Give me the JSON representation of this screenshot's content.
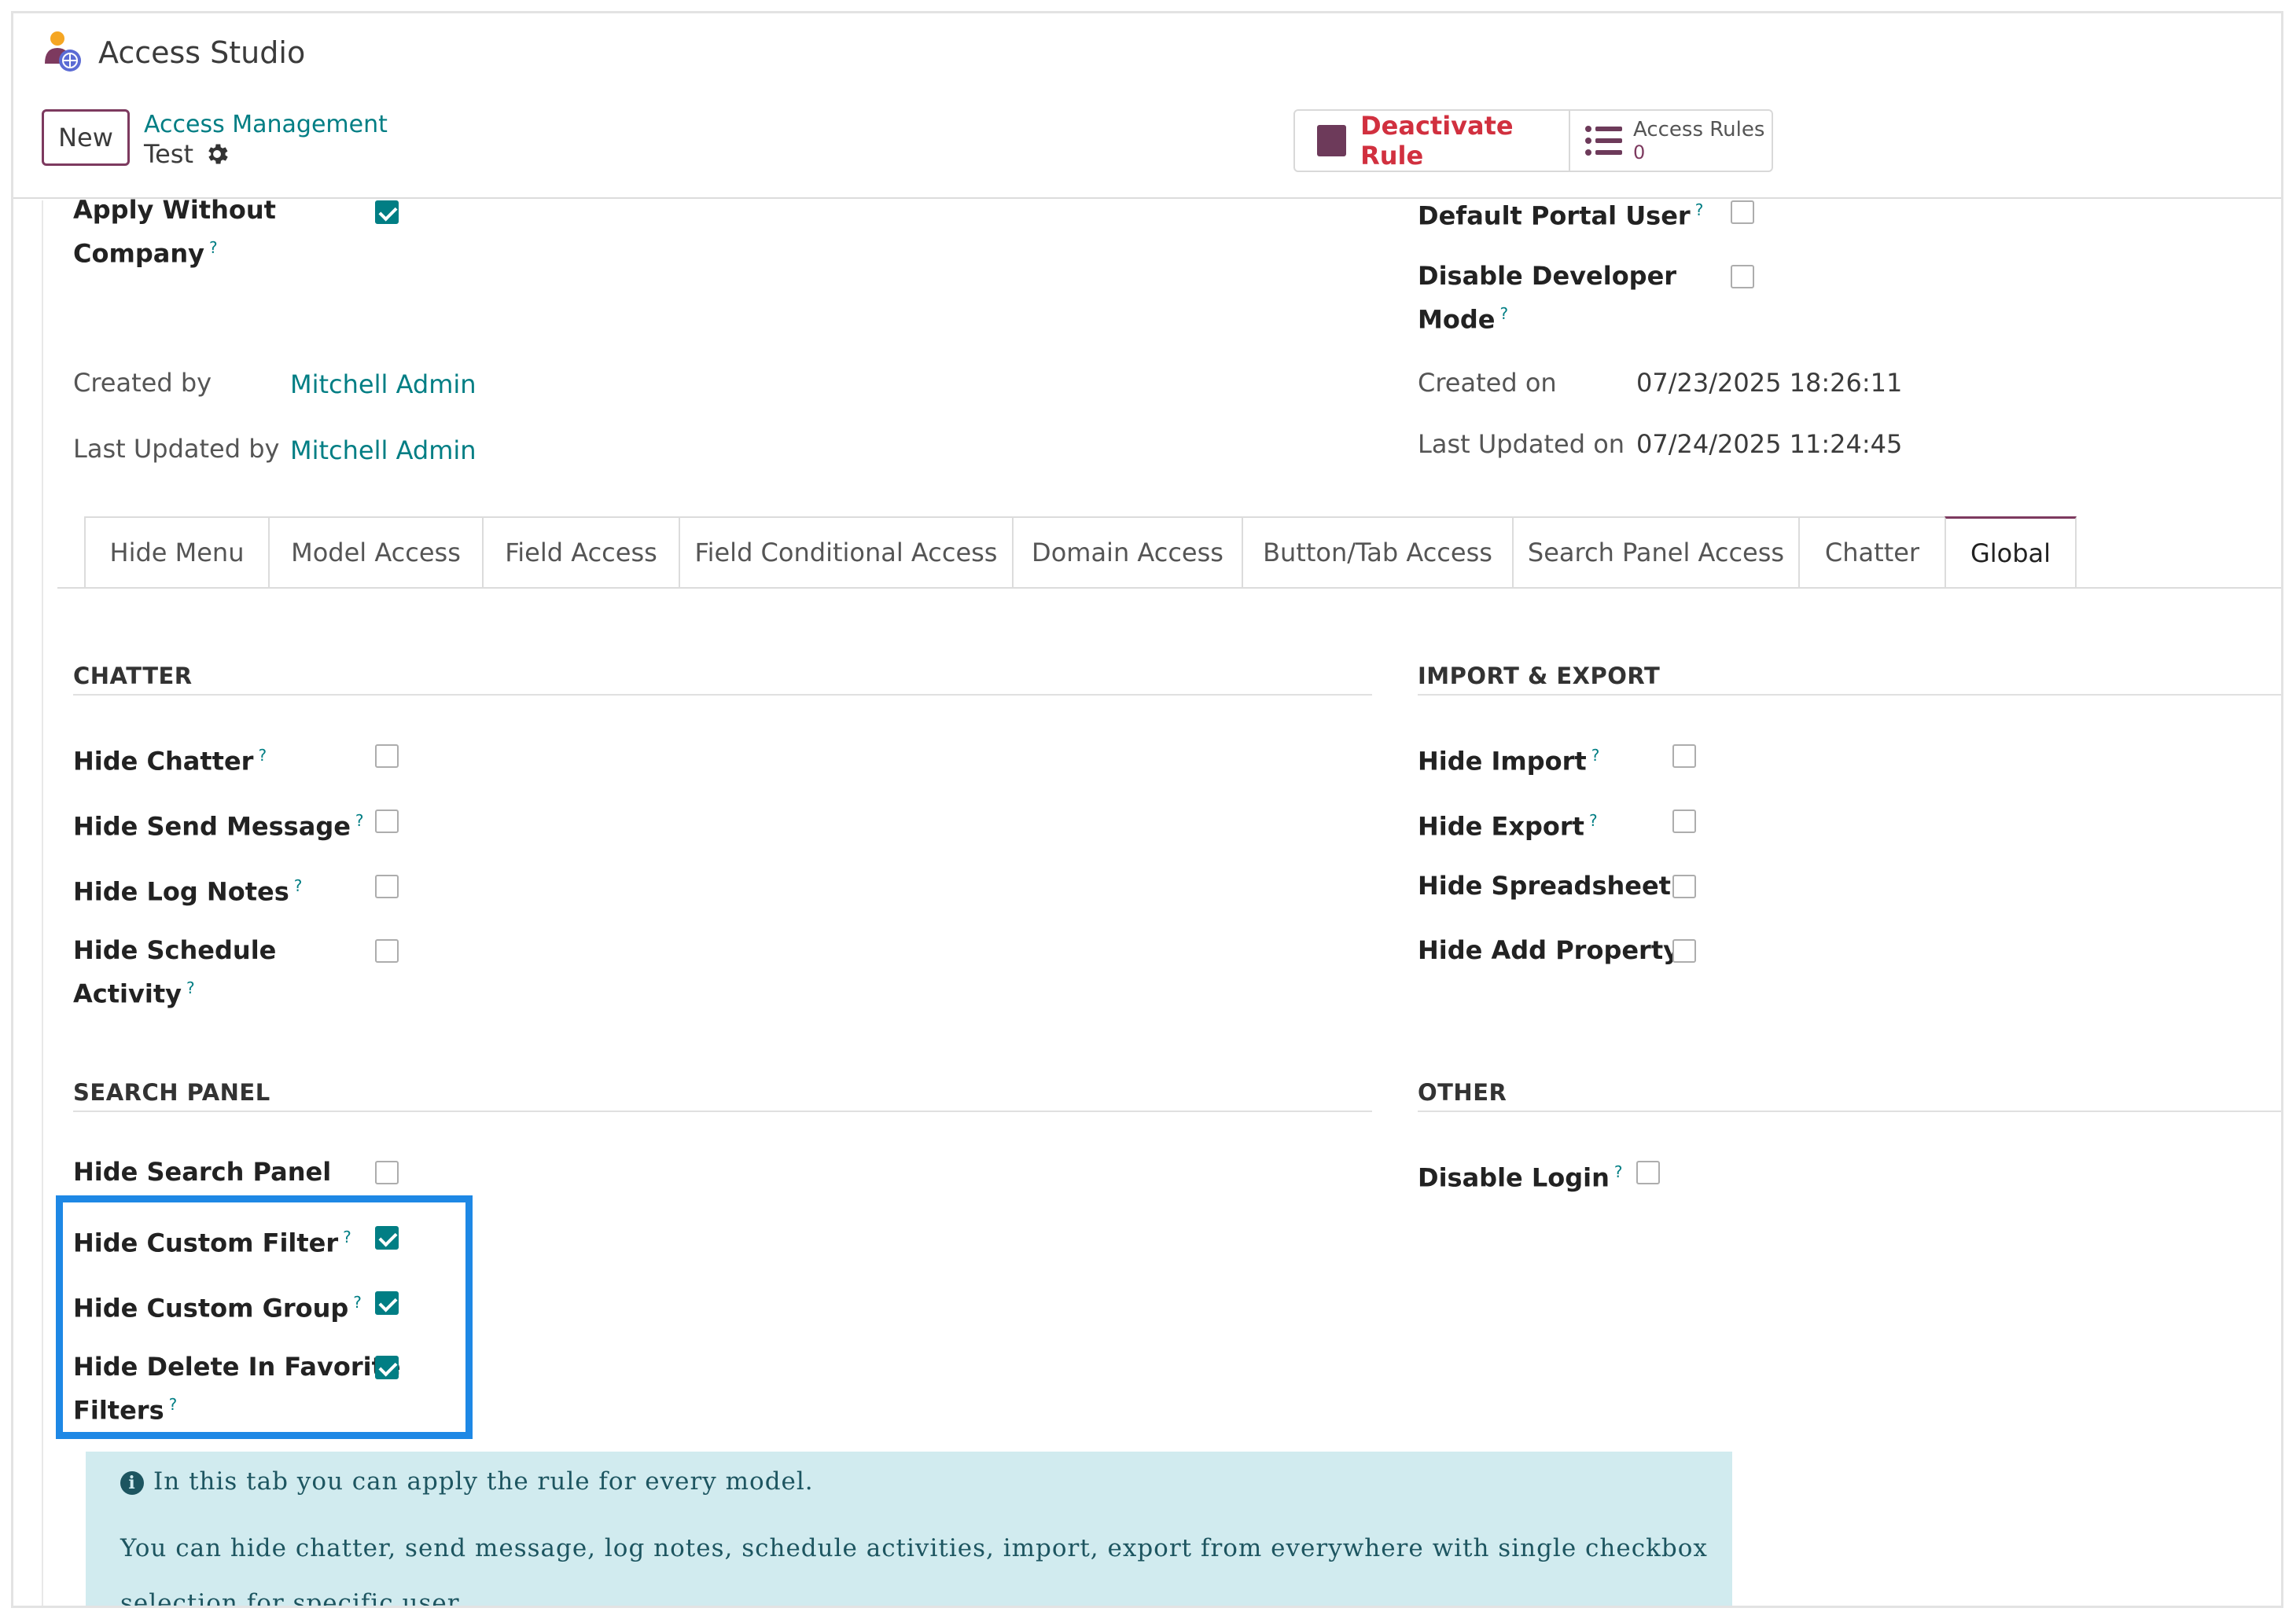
{
  "app": {
    "title": "Access Studio"
  },
  "header": {
    "new_label": "New",
    "breadcrumb_parent": "Access Management",
    "breadcrumb_current": "Test",
    "deactivate_label": "Deactivate Rule",
    "access_rules_label": "Access Rules",
    "access_rules_count": "0"
  },
  "top_fields": {
    "apply_without_company": {
      "label_line1": "Apply Without",
      "label_line2": "Company",
      "checked": true
    },
    "default_portal_user": {
      "label": "Default Portal User",
      "checked": false
    },
    "disable_developer_mode": {
      "label_line1": "Disable Developer",
      "label_line2": "Mode",
      "checked": false
    },
    "created_by": {
      "label": "Created by",
      "value": "Mitchell Admin"
    },
    "last_updated_by": {
      "label": "Last Updated by",
      "value": "Mitchell Admin"
    },
    "created_on": {
      "label": "Created on",
      "value": "07/23/2025 18:26:11"
    },
    "last_updated_on": {
      "label": "Last Updated on",
      "value": "07/24/2025 11:24:45"
    }
  },
  "tabs": [
    {
      "label": "Hide Menu",
      "active": false
    },
    {
      "label": "Model Access",
      "active": false
    },
    {
      "label": "Field Access",
      "active": false
    },
    {
      "label": "Field Conditional Access",
      "active": false
    },
    {
      "label": "Domain Access",
      "active": false
    },
    {
      "label": "Button/Tab Access",
      "active": false
    },
    {
      "label": "Search Panel Access",
      "active": false
    },
    {
      "label": "Chatter",
      "active": false
    },
    {
      "label": "Global",
      "active": true
    }
  ],
  "sections": {
    "chatter": {
      "title": "CHATTER",
      "hide_chatter": {
        "label": "Hide Chatter",
        "checked": false
      },
      "hide_send_message": {
        "label": "Hide Send Message",
        "checked": false
      },
      "hide_log_notes": {
        "label": "Hide Log Notes",
        "checked": false
      },
      "hide_schedule_activity": {
        "label_line1": "Hide Schedule",
        "label_line2": "Activity",
        "checked": false
      }
    },
    "import_export": {
      "title": "IMPORT & EXPORT",
      "hide_import": {
        "label": "Hide Import",
        "checked": false
      },
      "hide_export": {
        "label": "Hide Export",
        "checked": false
      },
      "hide_spreadsheet": {
        "label": "Hide Spreadsheet",
        "checked": false
      },
      "hide_add_property": {
        "label": "Hide Add Property",
        "checked": false
      }
    },
    "search_panel": {
      "title": "SEARCH PANEL",
      "hide_search_panel": {
        "label": "Hide Search Panel",
        "checked": false
      },
      "hide_custom_filter": {
        "label": "Hide Custom Filter",
        "checked": true
      },
      "hide_custom_group": {
        "label": "Hide Custom Group",
        "checked": true
      },
      "hide_delete_favorite": {
        "label_line1": "Hide Delete In Favorite",
        "label_line2": "Filters",
        "checked": true
      }
    },
    "other": {
      "title": "OTHER",
      "disable_login": {
        "label": "Disable Login",
        "checked": false
      }
    }
  },
  "info": {
    "line1": "In this tab you can apply the rule for every model.",
    "line2": "You can hide chatter, send message, log notes, schedule activities, import, export from everywhere with single checkbox selection for specific user."
  },
  "colors": {
    "brand": "#7d3a5f",
    "link": "#017e84",
    "danger": "#d1303f",
    "highlight": "#1e88e5",
    "info_bg": "#d1ebef"
  },
  "icons": {
    "app": "access-studio-icon",
    "gear": "gear-icon",
    "list": "list-icon",
    "info": "info-icon",
    "help": "help-question-mark"
  }
}
